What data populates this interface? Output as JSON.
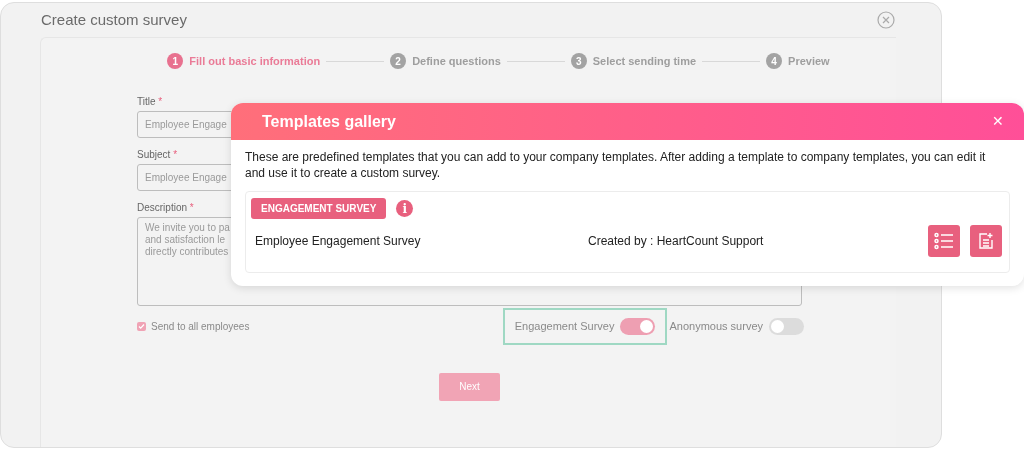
{
  "window": {
    "title": "Create custom survey"
  },
  "steps": [
    {
      "number": "1",
      "label": "Fill out basic information",
      "selected": true
    },
    {
      "number": "2",
      "label": "Define questions",
      "selected": false
    },
    {
      "number": "3",
      "label": "Select sending time",
      "selected": false
    },
    {
      "number": "4",
      "label": "Preview",
      "selected": false
    }
  ],
  "form": {
    "fields": [
      {
        "label": "Title",
        "required": "*",
        "value": "Employee Engage"
      },
      {
        "label": "Subject",
        "required": "*",
        "value": "Employee Engage"
      }
    ],
    "description": {
      "label": "Description",
      "required": "*",
      "lines": [
        "We invite you to pa",
        "and satisfaction le",
        "directly contributes"
      ]
    },
    "send_to_all": {
      "label": "Send to all employees",
      "checked": true
    },
    "toggles": [
      {
        "label": "Engagement Survey",
        "on": true,
        "highlighted": true
      },
      {
        "label": "Anonymous survey",
        "on": false,
        "highlighted": false
      }
    ],
    "next_button": "Next"
  },
  "modal": {
    "title": "Templates gallery",
    "close": "✕",
    "intro": "These are predefined templates that you can add to your company templates. After adding a template to company templates, you can edit it and use it to create a custom survey.",
    "templates": [
      {
        "tag": "ENGAGEMENT SURVEY",
        "info": "i",
        "name": "Employee Engagement Survey",
        "creator": "Created by : HeartCount Support"
      }
    ]
  }
}
